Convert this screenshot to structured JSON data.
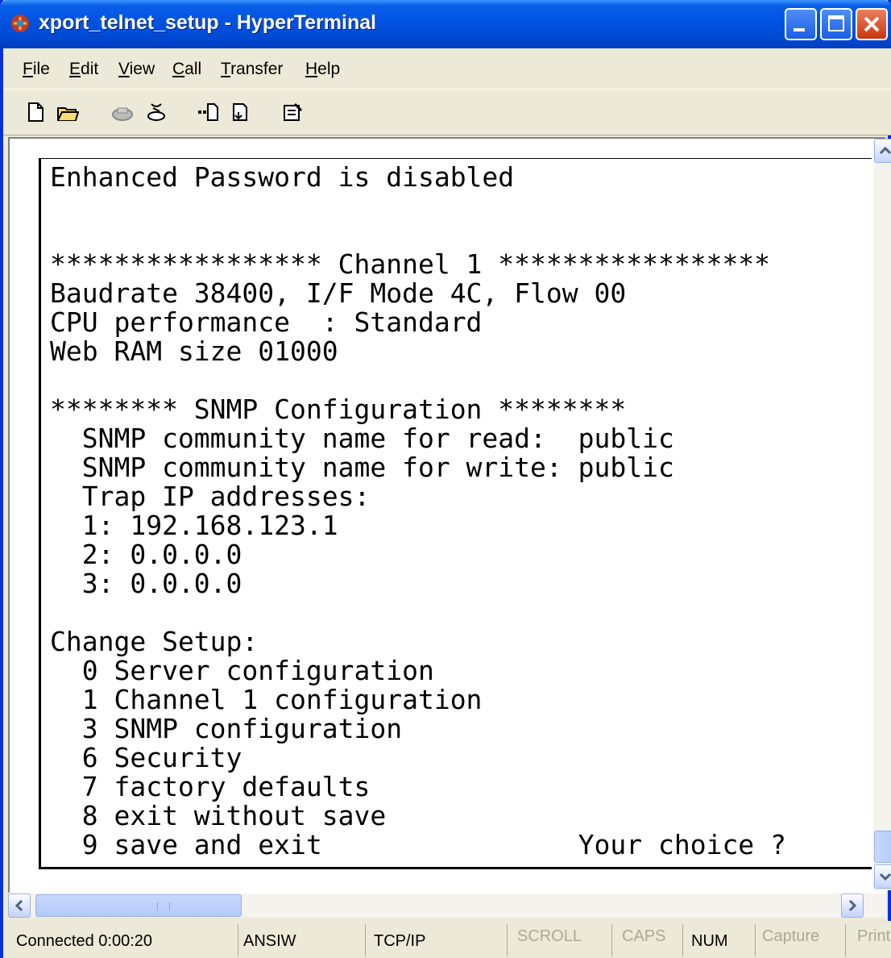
{
  "window": {
    "title": "xport_telnet_setup - HyperTerminal",
    "controls": {
      "minimize": "minimize-icon",
      "maximize": "maximize-icon",
      "close": "close-icon"
    }
  },
  "menu": [
    {
      "label": "File",
      "underline": "F",
      "rest": "ile"
    },
    {
      "label": "Edit",
      "underline": "E",
      "rest": "dit"
    },
    {
      "label": "View",
      "underline": "V",
      "rest": "iew"
    },
    {
      "label": "Call",
      "underline": "C",
      "rest": "all"
    },
    {
      "label": "Transfer",
      "underline": "T",
      "rest": "ransfer"
    },
    {
      "label": "Help",
      "underline": "H",
      "rest": "elp"
    }
  ],
  "toolbar": {
    "icons": [
      "new-icon",
      "open-icon",
      "connect-icon",
      "disconnect-icon",
      "send-file-icon",
      "receive-file-icon",
      "properties-icon"
    ]
  },
  "terminal": {
    "lines": [
      "Enhanced Password is disabled",
      "",
      "",
      "***************** Channel 1 *****************",
      "Baudrate 38400, I/F Mode 4C, Flow 00",
      "CPU performance  : Standard",
      "Web RAM size 01000",
      "",
      "******** SNMP Configuration ********",
      "  SNMP community name for read:  public",
      "  SNMP community name for write: public",
      "  Trap IP addresses:",
      "  1: 192.168.123.1",
      "  2: 0.0.0.0",
      "  3: 0.0.0.0",
      "",
      "Change Setup:",
      "  0 Server configuration",
      "  1 Channel 1 configuration",
      "  3 SNMP configuration",
      "  6 Security",
      "  7 factory defaults",
      "  8 exit without save",
      "  9 save and exit                Your choice ?"
    ]
  },
  "status": {
    "connected": "Connected 0:00:20",
    "emulation": "ANSIW",
    "protocol": "TCP/IP",
    "scroll": "SCROLL",
    "caps": "CAPS",
    "num": "NUM",
    "capture": "Capture",
    "print": "Print"
  },
  "colors": {
    "titlebar": "#0054e3",
    "chrome": "#ece9d8",
    "terminal_bg": "#ffffff",
    "terminal_fg": "#000000"
  }
}
